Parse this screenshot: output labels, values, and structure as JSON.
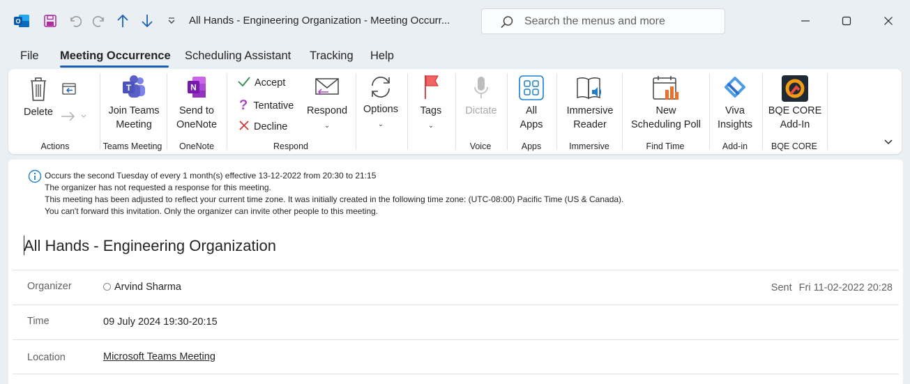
{
  "window": {
    "title": "All Hands - Engineering Organization  -  Meeting Occurr...",
    "search_placeholder": "Search the menus and more"
  },
  "menu_tabs": [
    "File",
    "Meeting Occurrence",
    "Scheduling Assistant",
    "Tracking",
    "Help"
  ],
  "ribbon": {
    "actions": {
      "delete": "Delete",
      "group": "Actions"
    },
    "teams": {
      "line1": "Join Teams",
      "line2": "Meeting",
      "group": "Teams Meeting"
    },
    "onenote": {
      "line1": "Send to",
      "line2": "OneNote",
      "group": "OneNote"
    },
    "respond": {
      "accept": "Accept",
      "tentative": "Tentative",
      "decline": "Decline",
      "respond": "Respond",
      "group": "Respond"
    },
    "options": {
      "label": "Options"
    },
    "tags": {
      "label": "Tags"
    },
    "voice": {
      "dictate": "Dictate",
      "group": "Voice"
    },
    "apps": {
      "line1": "All",
      "line2": "Apps",
      "group": "Apps"
    },
    "immersive": {
      "line1": "Immersive",
      "line2": "Reader",
      "group": "Immersive"
    },
    "findtime": {
      "line1": "New",
      "line2": "Scheduling Poll",
      "group": "Find Time"
    },
    "viva": {
      "line1": "Viva",
      "line2": "Insights",
      "group": "Add-in"
    },
    "bqe": {
      "line1": "BQE CORE",
      "line2": "Add-In",
      "group": "BQE CORE"
    }
  },
  "info_lines": [
    "Occurs the second Tuesday of every 1 month(s) effective 13-12-2022 from 20:30 to 21:15",
    "The organizer has not requested a response for this meeting.",
    "This meeting has been adjusted to reflect your current time zone. It was initially created in the following time zone: (UTC-08:00) Pacific Time (US & Canada).",
    "You can't forward this invitation. Only the organizer can invite other people to this meeting."
  ],
  "subject": "All Hands - Engineering Organization",
  "organizer": {
    "label": "Organizer",
    "name": "Arvind Sharma"
  },
  "sent": {
    "label": "Sent",
    "value": "Fri 11-02-2022 20:28"
  },
  "time": {
    "label": "Time",
    "value": "09 July 2024 19:30-20:15"
  },
  "location": {
    "label": "Location",
    "value": "Microsoft Teams Meeting"
  },
  "colors": {
    "accent": "#1a5fb4",
    "outlook_blue": "#0f6cbd",
    "onenote": "#7719aa",
    "teams": "#5b5fc7",
    "flag": "#e43b3b"
  }
}
